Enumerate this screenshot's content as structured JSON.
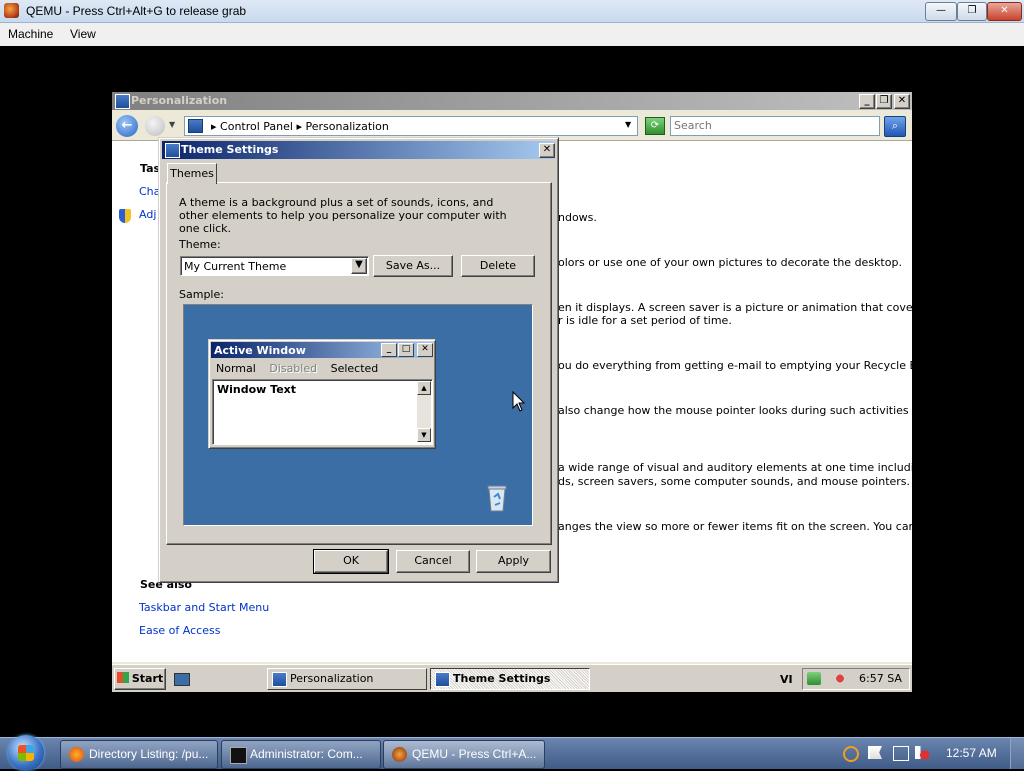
{
  "host": {
    "title": "QEMU - Press Ctrl+Alt+G to release grab",
    "menu": [
      "Machine",
      "View"
    ],
    "caption_buttons": {
      "minimize": "—",
      "maximize": "❐",
      "close": "✕"
    }
  },
  "personalization": {
    "title": "Personalization",
    "address": "Control Panel  ▸  Personalization",
    "address_parts": [
      "Control Panel",
      "Personalization"
    ],
    "search_placeholder": "Search",
    "tasks_header": "Tas",
    "tasks": [
      "Cha",
      "Adj"
    ],
    "descriptions": [
      "ndows.",
      "olors or use one of your own pictures to decorate the desktop.",
      "en it displays. A screen saver is a picture or animation that covers your",
      "r is idle for a set period of time.",
      "ou do everything from getting e-mail to emptying your Recycle Bin.",
      "also change how the mouse pointer looks during such activities as",
      "a wide range of visual and auditory elements at one time including the",
      "ds, screen savers, some computer sounds, and mouse pointers.",
      "anges the view so more or fewer items fit on the screen. You can also"
    ],
    "see_also_header": "See also",
    "see_also": [
      "Taskbar and Start Menu",
      "Ease of Access"
    ]
  },
  "theme_dialog": {
    "title": "Theme Settings",
    "tab": "Themes",
    "description": "A theme is a background plus a set of sounds, icons, and other elements to help you personalize your computer with one click.",
    "theme_label": "Theme:",
    "theme_value": "My Current Theme",
    "save_as": "Save As...",
    "delete": "Delete",
    "sample_label": "Sample:",
    "sample": {
      "window_title": "Active Window",
      "menu": [
        "Normal",
        "Disabled",
        "Selected"
      ],
      "window_text": "Window Text"
    },
    "ok": "OK",
    "cancel": "Cancel",
    "apply": "Apply"
  },
  "guest_taskbar": {
    "start": "Start",
    "tasks": [
      "Personalization",
      "Theme Settings"
    ],
    "language": "VI",
    "clock": "6:57 SA"
  },
  "host_taskbar": {
    "tasks": [
      "Directory Listing: /pu...",
      "Administrator:  Com...",
      "QEMU - Press Ctrl+A..."
    ],
    "clock": "12:57 AM"
  },
  "colors": {
    "desktop_sample": "#3a6ea5",
    "active_title_start": "#0a246a",
    "active_title_end": "#a6caf0",
    "link": "#0033cc",
    "classic_face": "#d4d0c8"
  }
}
